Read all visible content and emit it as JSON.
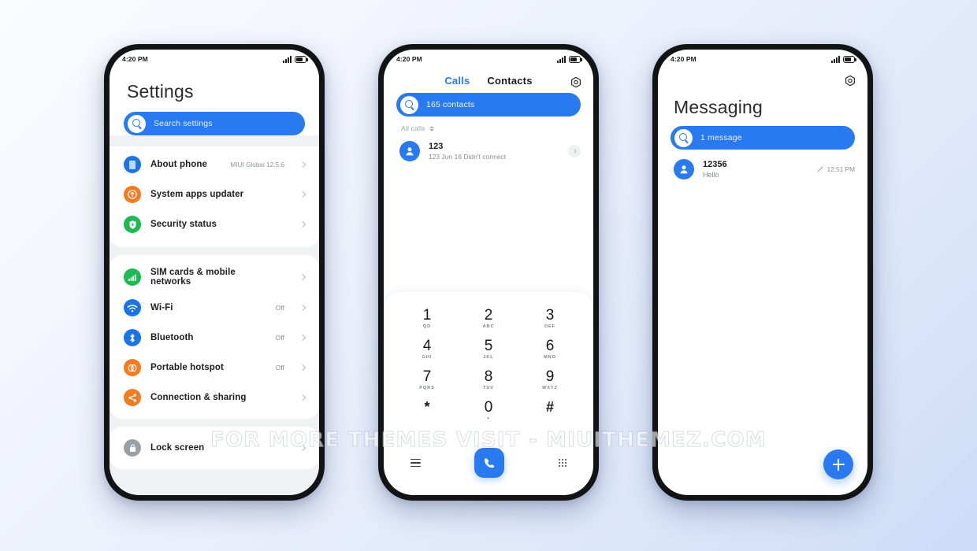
{
  "background": {
    "accent": "#2979f0"
  },
  "watermark": {
    "text": "FOR MORE THEMES VISIT - MIUITHEMEZ.COM"
  },
  "status_bar": {
    "time": "4:20 PM",
    "signal_icon": "signal-bars-icon",
    "battery_icon": "battery-icon"
  },
  "settings_phone": {
    "title": "Settings",
    "search": {
      "placeholder": "Search settings",
      "icon": "search-icon"
    },
    "group_one": [
      {
        "label": "About phone",
        "value": "MIUI Global 12.5.6",
        "icon": "phone-icon",
        "color": "#1a73e8"
      },
      {
        "label": "System apps updater",
        "value": "",
        "icon": "update-arrow-icon",
        "color": "#f47b20"
      },
      {
        "label": "Security status",
        "value": "",
        "icon": "shield-icon",
        "color": "#1fb954"
      }
    ],
    "group_two": [
      {
        "label": "SIM cards & mobile networks",
        "value": "",
        "icon": "signal-bars-icon",
        "color": "#1fb954"
      },
      {
        "label": "Wi-Fi",
        "value": "Off",
        "icon": "wifi-icon",
        "color": "#1a73e8"
      },
      {
        "label": "Bluetooth",
        "value": "Off",
        "icon": "bluetooth-icon",
        "color": "#1a73e8"
      },
      {
        "label": "Portable hotspot",
        "value": "Off",
        "icon": "hotspot-icon",
        "color": "#f47b20"
      },
      {
        "label": "Connection & sharing",
        "value": "",
        "icon": "share-nodes-icon",
        "color": "#f47b20"
      }
    ],
    "group_three": [
      {
        "label": "Lock screen",
        "value": "",
        "icon": "lock-icon",
        "color": "#9aa0a6"
      }
    ]
  },
  "dialer_phone": {
    "tabs": [
      {
        "label": "Calls",
        "active": true
      },
      {
        "label": "Contacts",
        "active": false
      }
    ],
    "settings_icon": "gear-icon",
    "search": {
      "placeholder": "165 contacts",
      "icon": "search-icon"
    },
    "filter": {
      "label": "All calls",
      "icon": "sort-updown-icon"
    },
    "call_log": [
      {
        "name": "123",
        "detail": "123  Jun 16 Didn't connect",
        "avatar": "person-icon"
      }
    ],
    "keypad": [
      {
        "num": "1",
        "sub": "QD"
      },
      {
        "num": "2",
        "sub": "ABC"
      },
      {
        "num": "3",
        "sub": "DEF"
      },
      {
        "num": "4",
        "sub": "GHI"
      },
      {
        "num": "5",
        "sub": "JKL"
      },
      {
        "num": "6",
        "sub": "MNO"
      },
      {
        "num": "7",
        "sub": "PQRS"
      },
      {
        "num": "8",
        "sub": "TUV"
      },
      {
        "num": "9",
        "sub": "WXYZ"
      },
      {
        "num": "*",
        "sub": ""
      },
      {
        "num": "0",
        "sub": "+"
      },
      {
        "num": "#",
        "sub": ""
      }
    ],
    "bottom_bar": {
      "left_icon": "list-icon",
      "call_icon": "phone-call-icon",
      "right_icon": "dialpad-grid-icon"
    }
  },
  "messaging_phone": {
    "settings_icon": "gear-icon",
    "title": "Messaging",
    "search": {
      "placeholder": "1 message",
      "icon": "search-icon"
    },
    "threads": [
      {
        "name": "12356",
        "preview": "Hello",
        "time": "12:51 PM",
        "status_icon": "pencil-icon",
        "avatar": "person-icon"
      }
    ],
    "fab": {
      "icon": "plus-icon",
      "label": "New message"
    }
  }
}
